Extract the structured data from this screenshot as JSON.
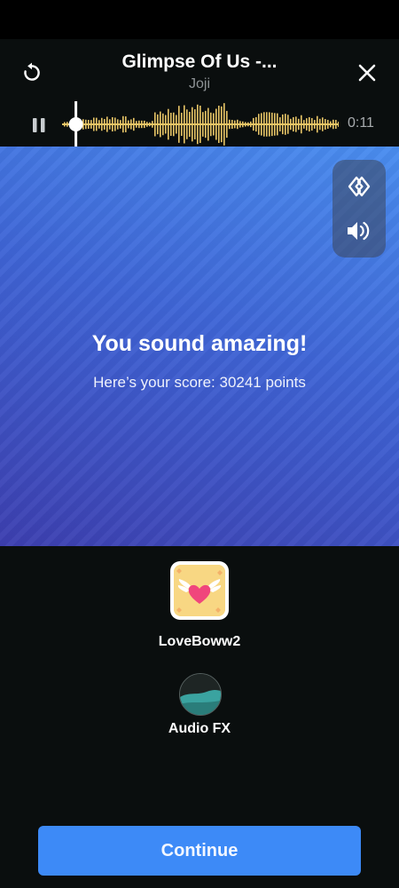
{
  "player": {
    "title": "Glimpse Of Us -...",
    "artist": "Joji",
    "elapsed_time": "0:11",
    "playhead_progress": 0.05,
    "waveform_color": "#e8c667"
  },
  "result": {
    "headline": "You sound amazing!",
    "score_text": "Here’s your score: 30241 points"
  },
  "side_controls": {
    "items": [
      "duet-icon",
      "volume-icon"
    ]
  },
  "effects": {
    "selected_effect_label": "LoveBoww2",
    "audio_fx_label": "Audio FX"
  },
  "actions": {
    "continue_label": "Continue"
  },
  "colors": {
    "accent": "#3d8af7",
    "background": "#0a0e0e",
    "stage_top": "#4a8ef0",
    "stage_bottom": "#3d3fb0"
  }
}
